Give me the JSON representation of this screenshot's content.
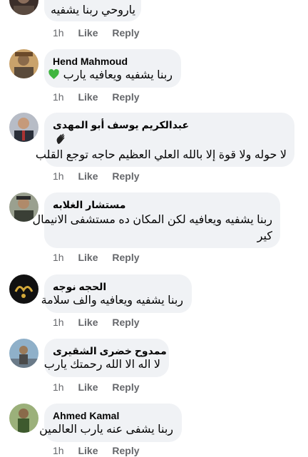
{
  "comments": [
    {
      "name": "",
      "text": "ياروحي ربنا  يشفيه",
      "time": "1h",
      "like": "Like",
      "reply": "Reply",
      "avatar_colors": [
        "#3b2e2a",
        "#8a6d5b"
      ]
    },
    {
      "name": "Hend Mahmoud",
      "text": "ربنا يشفيه ويعافيه يارب",
      "emoji": "green-heart-icon",
      "time": "1h",
      "like": "Like",
      "reply": "Reply",
      "avatar_colors": [
        "#5a4a3a",
        "#c9a26b"
      ]
    },
    {
      "name": "عبدالكريم يوسف أبو المهدى",
      "emoji": "waving-hand-icon",
      "text": "لا حوله ولا قوة إلا بالله العلي العظيم حاجه توجع القلب",
      "time": "1h",
      "like": "Like",
      "reply": "Reply",
      "avatar_colors": [
        "#2a2f3a",
        "#b7bcc6"
      ]
    },
    {
      "name": "مستشار الغلابه",
      "text_lines": [
        "ربنا يشفيه ويعافيه لكن المكان ده مستشفى الانيمال",
        "كير"
      ],
      "time": "1h",
      "like": "Like",
      "reply": "Reply",
      "avatar_colors": [
        "#3a3f36",
        "#9aa08f"
      ]
    },
    {
      "name": "الحجه نوجه",
      "text": "ربنا يشفيه ويعافيه والف سلامة",
      "time": "1h",
      "like": "Like",
      "reply": "Reply",
      "avatar_colors": [
        "#111111",
        "#d4a93a"
      ]
    },
    {
      "name": "ممدوح خضرى الشقيرى",
      "text": "لا اله الا الله  رحمتك يارب",
      "time": "1h",
      "like": "Like",
      "reply": "Reply",
      "avatar_colors": [
        "#8fb0c9",
        "#4a4a4a"
      ]
    },
    {
      "name": "Ahmed Kamal",
      "text": "ربنا يشفى عنه يارب العالمين",
      "time": "1h",
      "like": "Like",
      "reply": "Reply",
      "avatar_colors": [
        "#3e5a2e",
        "#9bb07a"
      ]
    }
  ]
}
